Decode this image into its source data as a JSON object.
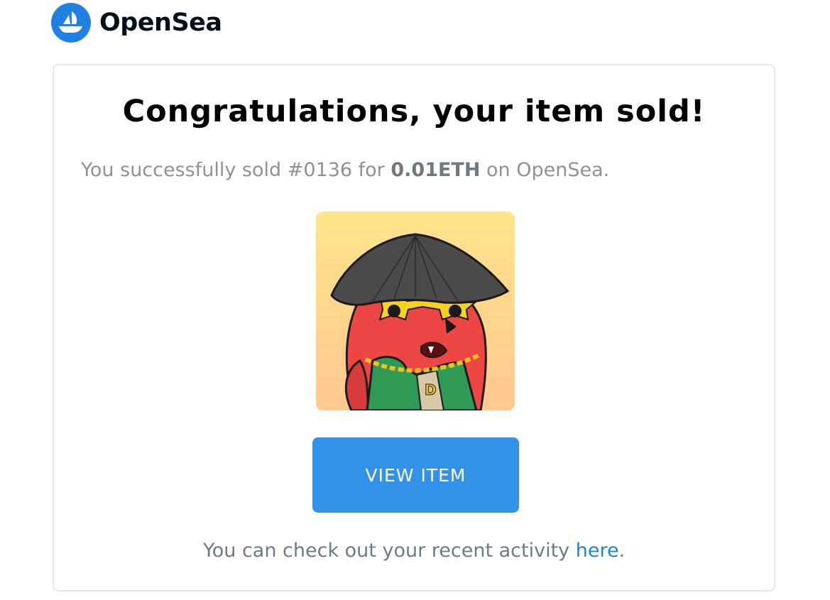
{
  "brand": {
    "name": "OpenSea",
    "logo_icon": "opensea-sailboat-icon",
    "color": "#2081e2"
  },
  "email": {
    "title": "Congratulations, your item sold!",
    "message_prefix": "You successfully sold #0136 for ",
    "amount": "0.01ETH",
    "message_suffix": " on OpenSea.",
    "image": {
      "subject": "red bird avatar with conical hat, star sunglasses and gold chain",
      "chain_letter": "D",
      "background_top": "#ffe48a",
      "background_bottom": "#ffc891"
    },
    "button_label": "VIEW ITEM",
    "button_color": "#3291e9",
    "footer_prefix": "You can check out your recent activity ",
    "footer_link": "here",
    "footer_suffix": "."
  }
}
